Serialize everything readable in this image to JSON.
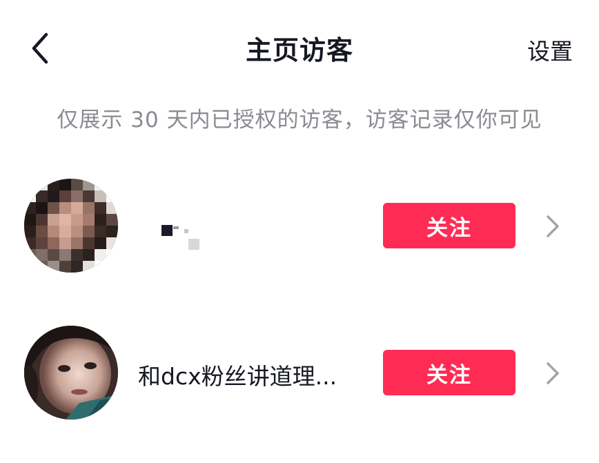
{
  "header": {
    "title": "主页访客",
    "settings_label": "设置",
    "back_icon": "chevron-left-icon"
  },
  "notice": "仅展示 30 天内已授权的访客，访客记录仅你可见",
  "visitors": [
    {
      "nickname": "",
      "follow_label": "关注",
      "avatar": "pixelated-avatar"
    },
    {
      "nickname": "和dcx粉丝讲道理...",
      "follow_label": "关注",
      "avatar": "portrait-avatar"
    }
  ],
  "colors": {
    "accent": "#fe2c55",
    "text_primary": "#161823",
    "text_secondary": "#8a8b91",
    "chevron": "#a3a4a8"
  }
}
